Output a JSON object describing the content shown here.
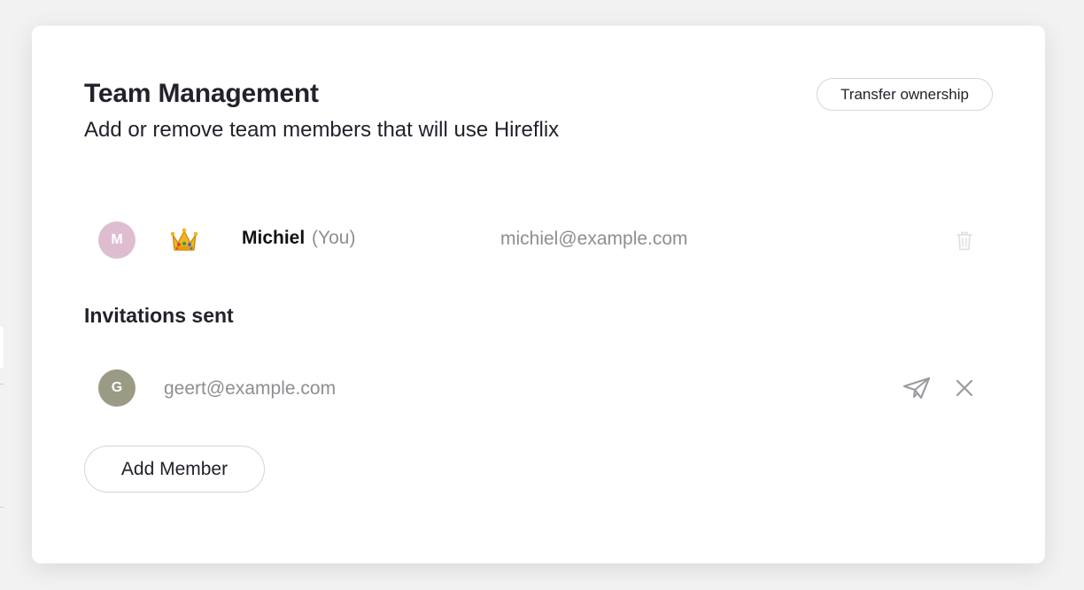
{
  "header": {
    "title": "Team Management",
    "subtitle": "Add or remove team members that will use Hireflix",
    "transfer_label": "Transfer ownership"
  },
  "members": [
    {
      "initial": "M",
      "avatar_color": "#dfbdd0",
      "owner_icon": "crown-icon",
      "name": "Michiel",
      "you_label": "(You)",
      "email": "michiel@example.com",
      "action_icon": "trash-icon"
    }
  ],
  "invitations": {
    "title": "Invitations sent",
    "items": [
      {
        "initial": "G",
        "avatar_color": "#9b9b85",
        "email": "geert@example.com",
        "resend_icon": "paper-plane-icon",
        "cancel_icon": "close-icon"
      }
    ]
  },
  "add_member_label": "Add Member",
  "colors": {
    "background": "#f2f2f3",
    "card": "#ffffff",
    "text": "#23222b",
    "muted": "#8e8e93",
    "border": "#d6d6da"
  }
}
